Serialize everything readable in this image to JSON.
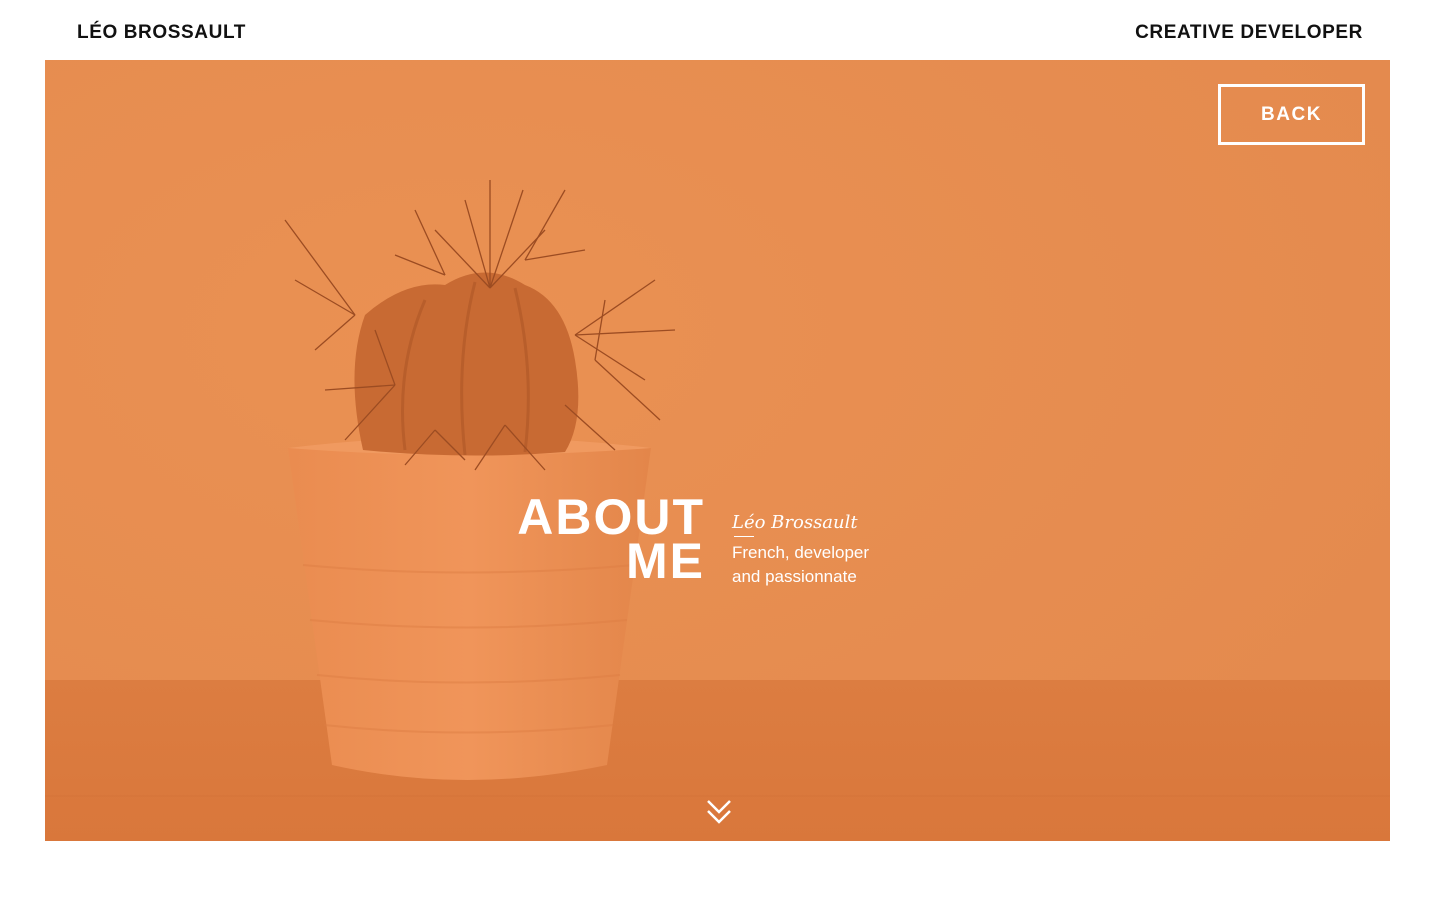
{
  "header": {
    "brand": "LÉO BROSSAULT",
    "role": "CREATIVE DEVELOPER"
  },
  "hero": {
    "background_color": "#e88f52",
    "back_label": "BACK",
    "title_line1": "ABOUT",
    "title_line2": "ME",
    "name": "Léo Brossault",
    "description_line1": "French, developer",
    "description_line2": "and passionnate",
    "scroll_icon": "double-chevron-down-icon"
  }
}
